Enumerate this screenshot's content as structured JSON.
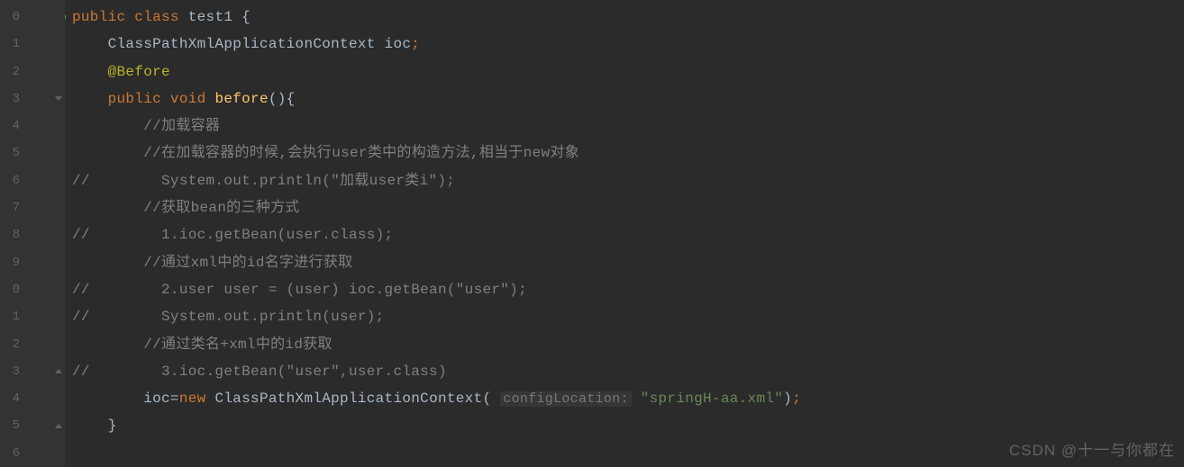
{
  "gutter": {
    "lines": [
      "0",
      "1",
      "2",
      "3",
      "4",
      "5",
      "6",
      "7",
      "8",
      "9",
      "0",
      "1",
      "2",
      "3",
      "4",
      "5",
      "6"
    ]
  },
  "code": {
    "l0": {
      "pre": "public class ",
      "cls": "test1",
      "post": " {"
    },
    "l1": {
      "indent": "    ",
      "type": "ClassPathXmlApplicationContext",
      "var": " ioc",
      "semi": ";"
    },
    "l2": {
      "indent": "    ",
      "anno": "@Before"
    },
    "l3": {
      "indent": "    ",
      "kw1": "public ",
      "kw2": "void ",
      "method": "before",
      "post": "(){"
    },
    "l4": {
      "indent": "        ",
      "comment": "//加载容器"
    },
    "l5": {
      "indent": "        ",
      "comment": "//在加载容器的时候,会执行user类中的构造方法,相当于new对象"
    },
    "l6": {
      "comment": "//        System.out.println(\"加载user类i\");"
    },
    "l7": {
      "indent": "        ",
      "comment": "//获取bean的三种方式"
    },
    "l8": {
      "comment": "//        1.ioc.getBean(user.class);"
    },
    "l9": {
      "indent": "        ",
      "comment": "//通过xml中的id名字进行获取"
    },
    "l10": {
      "comment": "//        2.user user = (user) ioc.getBean(\"user\");"
    },
    "l11": {
      "comment": "//        System.out.println(user);"
    },
    "l12": {
      "indent": "        ",
      "comment": "//通过类名+xml中的id获取"
    },
    "l13": {
      "comment": "//        3.ioc.getBean(\"user\",user.class)"
    },
    "l14": {
      "indent": "        ",
      "var": "ioc=",
      "kw": "new ",
      "ctor": "ClassPathXmlApplicationContext(",
      "hint": "configLocation:",
      "str": " \"springH-aa.xml\"",
      "post": ")",
      "semi": ";"
    },
    "l15": {
      "indent": "    ",
      "post": "}"
    }
  },
  "watermark": "CSDN @十一与你都在"
}
